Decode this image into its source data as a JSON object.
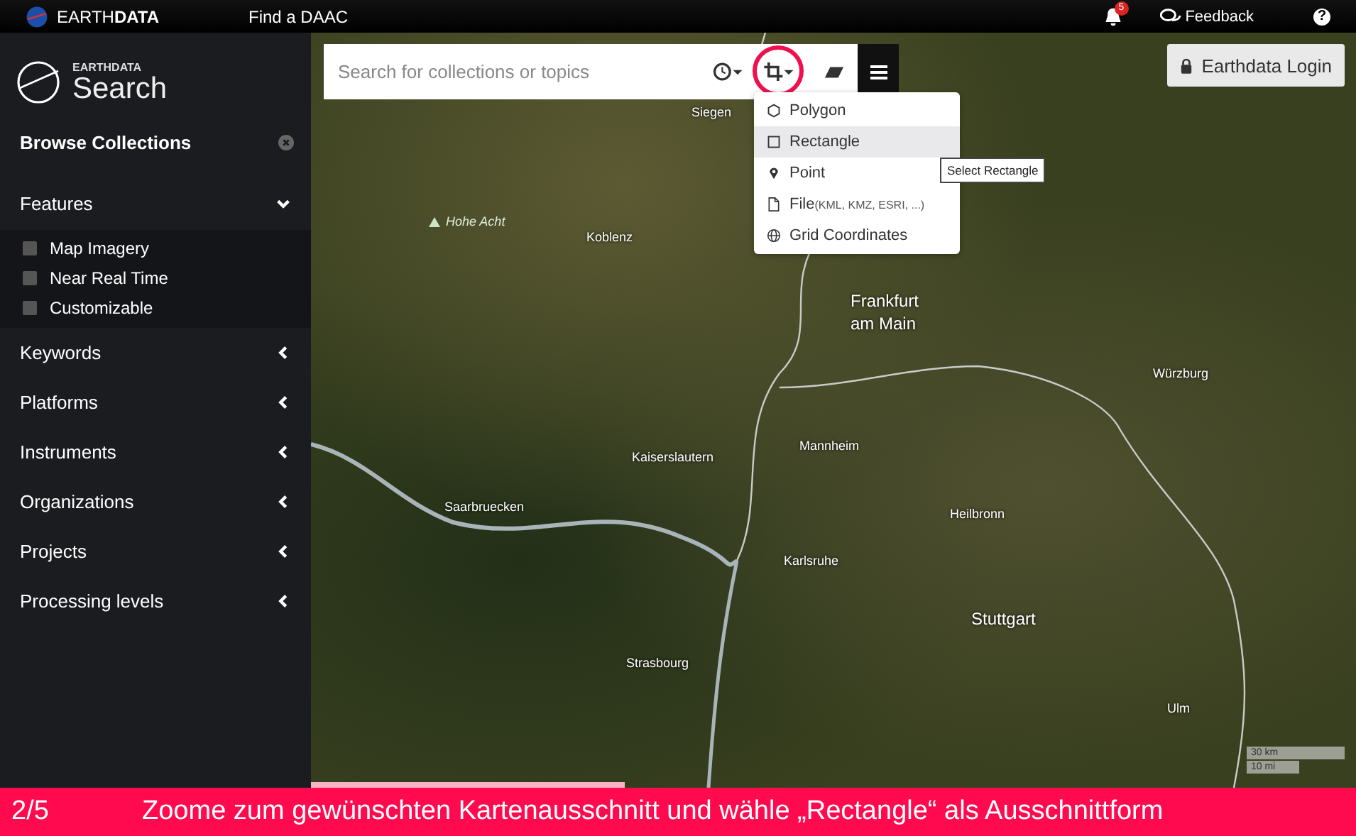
{
  "topbar": {
    "brand": "EARTH**DATA**",
    "find_daac": "Find a DAAC",
    "notifications": "5",
    "feedback": "Feedback",
    "help": "?"
  },
  "sidebar": {
    "logo_small": "EARTHDATA",
    "logo_big": "Search",
    "title": "Browse Collections",
    "sections": [
      {
        "label": "Features",
        "expanded": true,
        "options": [
          {
            "label": "Map Imagery",
            "checked": false
          },
          {
            "label": "Near Real Time",
            "checked": false
          },
          {
            "label": "Customizable",
            "checked": false
          }
        ]
      },
      {
        "label": "Keywords",
        "expanded": false
      },
      {
        "label": "Platforms",
        "expanded": false
      },
      {
        "label": "Instruments",
        "expanded": false
      },
      {
        "label": "Organizations",
        "expanded": false
      },
      {
        "label": "Projects",
        "expanded": false
      },
      {
        "label": "Processing levels",
        "expanded": false
      }
    ]
  },
  "search": {
    "placeholder": "Search for collections or topics"
  },
  "spatial_menu": {
    "items": [
      {
        "kind": "polygon",
        "label": "Polygon",
        "selected": false
      },
      {
        "kind": "rectangle",
        "label": "Rectangle",
        "selected": true
      },
      {
        "kind": "point",
        "label": "Point",
        "selected": false
      },
      {
        "kind": "file",
        "label": "File",
        "hint": "(KML, KMZ, ESRI, ...)",
        "selected": false
      },
      {
        "kind": "grid",
        "label": "Grid Coordinates",
        "selected": false
      }
    ],
    "tooltip": "Select Rectangle"
  },
  "login": "Earthdata Login",
  "map": {
    "labels": [
      {
        "text": "Siegen",
        "kind": "town"
      },
      {
        "text": "Hohe Acht",
        "kind": "peak"
      },
      {
        "text": "Koblenz",
        "kind": "town"
      },
      {
        "text": "Frankfurt am Main",
        "kind": "city"
      },
      {
        "text": "Würzburg",
        "kind": "town"
      },
      {
        "text": "Kaiserslautern",
        "kind": "town"
      },
      {
        "text": "Mannheim",
        "kind": "town"
      },
      {
        "text": "Saarbruecken",
        "kind": "town"
      },
      {
        "text": "Heilbronn",
        "kind": "town"
      },
      {
        "text": "Karlsruhe",
        "kind": "town"
      },
      {
        "text": "Stuttgart",
        "kind": "city"
      },
      {
        "text": "Strasbourg",
        "kind": "town"
      },
      {
        "text": "Ulm",
        "kind": "town"
      }
    ],
    "scale": [
      "30 km",
      "10 mi"
    ],
    "loading": {
      "level": 0.3
    }
  },
  "banner": {
    "step": "2/5",
    "text": "Zoome zum gewünschten Kartenausschnitt und wähle „Rectangle“ als Ausschnittform"
  }
}
